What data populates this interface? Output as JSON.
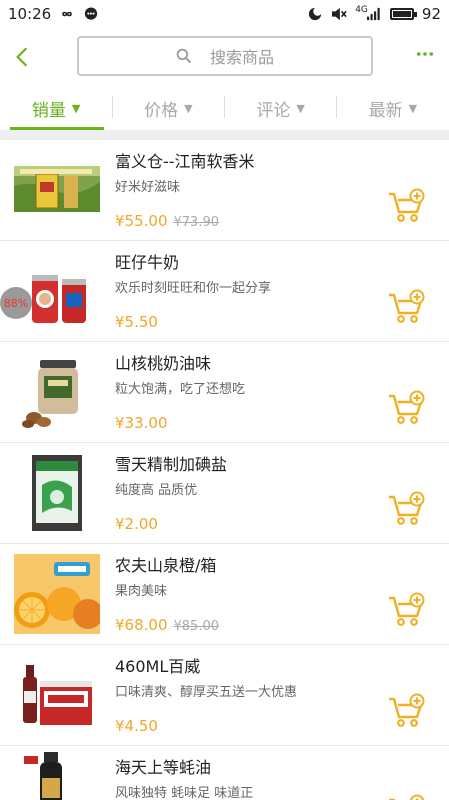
{
  "status_bar": {
    "time": "10:26",
    "battery": "92",
    "network": "4G"
  },
  "header": {
    "search_placeholder": "搜索商品",
    "accent_color": "#67b21d"
  },
  "tabs": [
    {
      "label": "销量",
      "active": true
    },
    {
      "label": "价格",
      "active": false
    },
    {
      "label": "评论",
      "active": false
    },
    {
      "label": "最新",
      "active": false
    }
  ],
  "products": [
    {
      "title": "富义仓--江南软香米",
      "subtitle": "好米好滋味",
      "price": "¥55.00",
      "old_price": "¥73.90"
    },
    {
      "title": " 旺仔牛奶",
      "subtitle": "欢乐时刻旺旺和你一起分享",
      "price": "¥5.50",
      "old_price": "",
      "badge": "88%"
    },
    {
      "title": "山核桃奶油味",
      "subtitle": "粒大饱满，吃了还想吃",
      "price": "¥33.00",
      "old_price": ""
    },
    {
      "title": "雪天精制加碘盐",
      "subtitle": "纯度高 品质优",
      "price": "¥2.00",
      "old_price": ""
    },
    {
      "title": "农夫山泉橙/箱",
      "subtitle": "果肉美味",
      "price": "¥68.00",
      "old_price": "¥85.00"
    },
    {
      "title": "460ML百威",
      "subtitle": "口味清爽、醇厚买五送一大优惠",
      "price": "¥4.50",
      "old_price": ""
    },
    {
      "title": "海天上等蚝油",
      "subtitle": "风味独特 蚝味足 味道正",
      "price": "",
      "old_price": ""
    }
  ],
  "colors": {
    "accent": "#67b21d",
    "price": "#f0a72a",
    "cart_icon": "#f0b022"
  }
}
